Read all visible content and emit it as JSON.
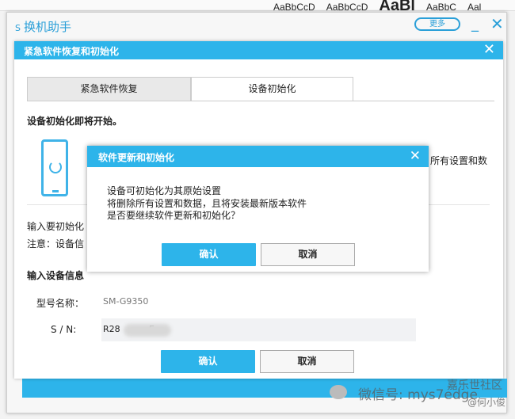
{
  "background": {
    "style_samples": [
      "AaBbCcD",
      "AaBbCcD",
      "AaBl",
      "AaBbC",
      "Aal"
    ]
  },
  "app": {
    "title": "换机助手",
    "logo": "S",
    "more_label": "更多",
    "minimize": "_",
    "close": "✕"
  },
  "dialog": {
    "title": "紧急软件恢复和初始化",
    "tabs": [
      {
        "label": "紧急软件恢复",
        "active": false
      },
      {
        "label": "设备初始化",
        "active": true
      }
    ],
    "heading": "设备初始化即将开始。",
    "partial_text": "所有设置和数",
    "enter_label": "输入要初始化",
    "note_label": "注意：设备信",
    "device_info_heading": "输入设备信息",
    "model_label": "型号名称：",
    "model_value": "SM-G9350",
    "sn_label": "S / N:",
    "sn_prefix": "R28",
    "sn_suffix": "E",
    "confirm": "确认",
    "cancel": "取消"
  },
  "modal": {
    "title": "软件更新和初始化",
    "lines": [
      "设备可初始化为其原始设置",
      "将删除所有设置和数据，且将安装最新版本软件",
      "是否要继续软件更新和初始化？"
    ],
    "confirm": "确认",
    "cancel": "取消"
  },
  "watermark": {
    "wechat": "微信号: mys7edge",
    "community": "嘉乐世社区",
    "author": "@何小俊"
  },
  "colors": {
    "accent": "#2db4ea"
  }
}
